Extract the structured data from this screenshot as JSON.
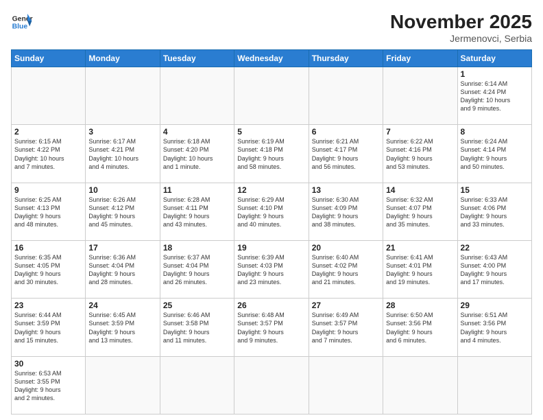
{
  "header": {
    "logo_general": "General",
    "logo_blue": "Blue",
    "month_title": "November 2025",
    "subtitle": "Jermenovci, Serbia"
  },
  "weekdays": [
    "Sunday",
    "Monday",
    "Tuesday",
    "Wednesday",
    "Thursday",
    "Friday",
    "Saturday"
  ],
  "weeks": [
    [
      {
        "day": "",
        "info": ""
      },
      {
        "day": "",
        "info": ""
      },
      {
        "day": "",
        "info": ""
      },
      {
        "day": "",
        "info": ""
      },
      {
        "day": "",
        "info": ""
      },
      {
        "day": "",
        "info": ""
      },
      {
        "day": "1",
        "info": "Sunrise: 6:14 AM\nSunset: 4:24 PM\nDaylight: 10 hours\nand 9 minutes."
      }
    ],
    [
      {
        "day": "2",
        "info": "Sunrise: 6:15 AM\nSunset: 4:22 PM\nDaylight: 10 hours\nand 7 minutes."
      },
      {
        "day": "3",
        "info": "Sunrise: 6:17 AM\nSunset: 4:21 PM\nDaylight: 10 hours\nand 4 minutes."
      },
      {
        "day": "4",
        "info": "Sunrise: 6:18 AM\nSunset: 4:20 PM\nDaylight: 10 hours\nand 1 minute."
      },
      {
        "day": "5",
        "info": "Sunrise: 6:19 AM\nSunset: 4:18 PM\nDaylight: 9 hours\nand 58 minutes."
      },
      {
        "day": "6",
        "info": "Sunrise: 6:21 AM\nSunset: 4:17 PM\nDaylight: 9 hours\nand 56 minutes."
      },
      {
        "day": "7",
        "info": "Sunrise: 6:22 AM\nSunset: 4:16 PM\nDaylight: 9 hours\nand 53 minutes."
      },
      {
        "day": "8",
        "info": "Sunrise: 6:24 AM\nSunset: 4:14 PM\nDaylight: 9 hours\nand 50 minutes."
      }
    ],
    [
      {
        "day": "9",
        "info": "Sunrise: 6:25 AM\nSunset: 4:13 PM\nDaylight: 9 hours\nand 48 minutes."
      },
      {
        "day": "10",
        "info": "Sunrise: 6:26 AM\nSunset: 4:12 PM\nDaylight: 9 hours\nand 45 minutes."
      },
      {
        "day": "11",
        "info": "Sunrise: 6:28 AM\nSunset: 4:11 PM\nDaylight: 9 hours\nand 43 minutes."
      },
      {
        "day": "12",
        "info": "Sunrise: 6:29 AM\nSunset: 4:10 PM\nDaylight: 9 hours\nand 40 minutes."
      },
      {
        "day": "13",
        "info": "Sunrise: 6:30 AM\nSunset: 4:09 PM\nDaylight: 9 hours\nand 38 minutes."
      },
      {
        "day": "14",
        "info": "Sunrise: 6:32 AM\nSunset: 4:07 PM\nDaylight: 9 hours\nand 35 minutes."
      },
      {
        "day": "15",
        "info": "Sunrise: 6:33 AM\nSunset: 4:06 PM\nDaylight: 9 hours\nand 33 minutes."
      }
    ],
    [
      {
        "day": "16",
        "info": "Sunrise: 6:35 AM\nSunset: 4:05 PM\nDaylight: 9 hours\nand 30 minutes."
      },
      {
        "day": "17",
        "info": "Sunrise: 6:36 AM\nSunset: 4:04 PM\nDaylight: 9 hours\nand 28 minutes."
      },
      {
        "day": "18",
        "info": "Sunrise: 6:37 AM\nSunset: 4:04 PM\nDaylight: 9 hours\nand 26 minutes."
      },
      {
        "day": "19",
        "info": "Sunrise: 6:39 AM\nSunset: 4:03 PM\nDaylight: 9 hours\nand 23 minutes."
      },
      {
        "day": "20",
        "info": "Sunrise: 6:40 AM\nSunset: 4:02 PM\nDaylight: 9 hours\nand 21 minutes."
      },
      {
        "day": "21",
        "info": "Sunrise: 6:41 AM\nSunset: 4:01 PM\nDaylight: 9 hours\nand 19 minutes."
      },
      {
        "day": "22",
        "info": "Sunrise: 6:43 AM\nSunset: 4:00 PM\nDaylight: 9 hours\nand 17 minutes."
      }
    ],
    [
      {
        "day": "23",
        "info": "Sunrise: 6:44 AM\nSunset: 3:59 PM\nDaylight: 9 hours\nand 15 minutes."
      },
      {
        "day": "24",
        "info": "Sunrise: 6:45 AM\nSunset: 3:59 PM\nDaylight: 9 hours\nand 13 minutes."
      },
      {
        "day": "25",
        "info": "Sunrise: 6:46 AM\nSunset: 3:58 PM\nDaylight: 9 hours\nand 11 minutes."
      },
      {
        "day": "26",
        "info": "Sunrise: 6:48 AM\nSunset: 3:57 PM\nDaylight: 9 hours\nand 9 minutes."
      },
      {
        "day": "27",
        "info": "Sunrise: 6:49 AM\nSunset: 3:57 PM\nDaylight: 9 hours\nand 7 minutes."
      },
      {
        "day": "28",
        "info": "Sunrise: 6:50 AM\nSunset: 3:56 PM\nDaylight: 9 hours\nand 6 minutes."
      },
      {
        "day": "29",
        "info": "Sunrise: 6:51 AM\nSunset: 3:56 PM\nDaylight: 9 hours\nand 4 minutes."
      }
    ],
    [
      {
        "day": "30",
        "info": "Sunrise: 6:53 AM\nSunset: 3:55 PM\nDaylight: 9 hours\nand 2 minutes."
      },
      {
        "day": "",
        "info": ""
      },
      {
        "day": "",
        "info": ""
      },
      {
        "day": "",
        "info": ""
      },
      {
        "day": "",
        "info": ""
      },
      {
        "day": "",
        "info": ""
      },
      {
        "day": "",
        "info": ""
      }
    ]
  ]
}
